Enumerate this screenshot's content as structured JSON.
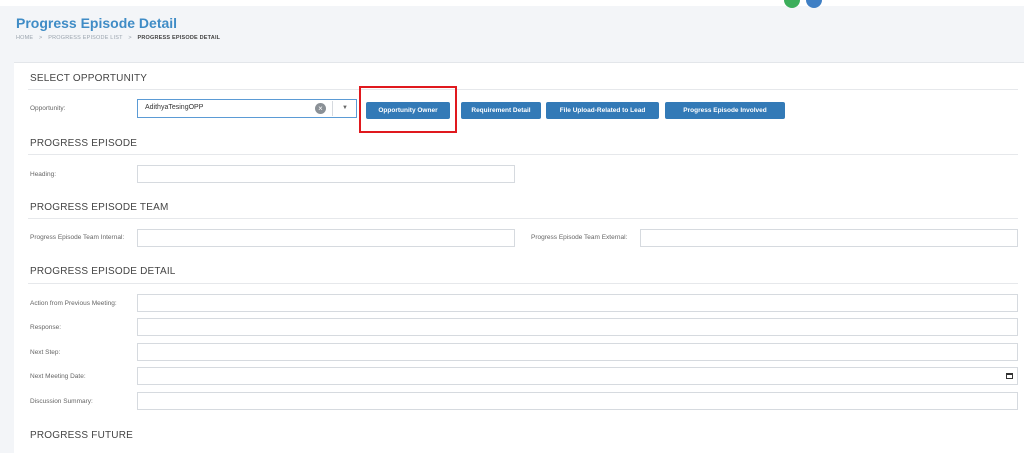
{
  "header": {
    "title": "Progress Episode Detail",
    "breadcrumb": [
      "HOME",
      "PROGRESS EPISODE LIST",
      "PROGRESS EPISODE DETAIL"
    ],
    "breadcrumb_sep": ">"
  },
  "sections": {
    "select_opportunity": "SELECT OPPORTUNITY",
    "progress_episode": "PROGRESS EPISODE",
    "progress_episode_team": "PROGRESS EPISODE TEAM",
    "progress_episode_detail": "PROGRESS EPISODE DETAIL",
    "progress_future": "PROGRESS FUTURE"
  },
  "opportunity": {
    "label": "Opportunity:",
    "value": "AdithyaTesingOPP",
    "clear_icon": "clear-circle-icon",
    "caret_icon": "caret-down-icon"
  },
  "buttons": {
    "opportunity_owner": "Opportunity Owner",
    "requirement_detail": "Requirement Detail",
    "file_upload": "File Upload-Related to Lead",
    "progress_episode_involved": "Progress Episode Involved"
  },
  "fields": {
    "heading": "Heading:",
    "team_internal": "Progress Episode Team Internal:",
    "team_external": "Progress Episode Team External:",
    "action_previous": "Action from Previous Meeting:",
    "response": "Response:",
    "next_step": "Next Step:",
    "next_meeting_date": "Next Meeting Date:",
    "discussion_summary": "Discussion Summary:"
  },
  "colors": {
    "accent": "#3f8cc6",
    "button": "#337ab7",
    "highlight": "#e0191e"
  }
}
